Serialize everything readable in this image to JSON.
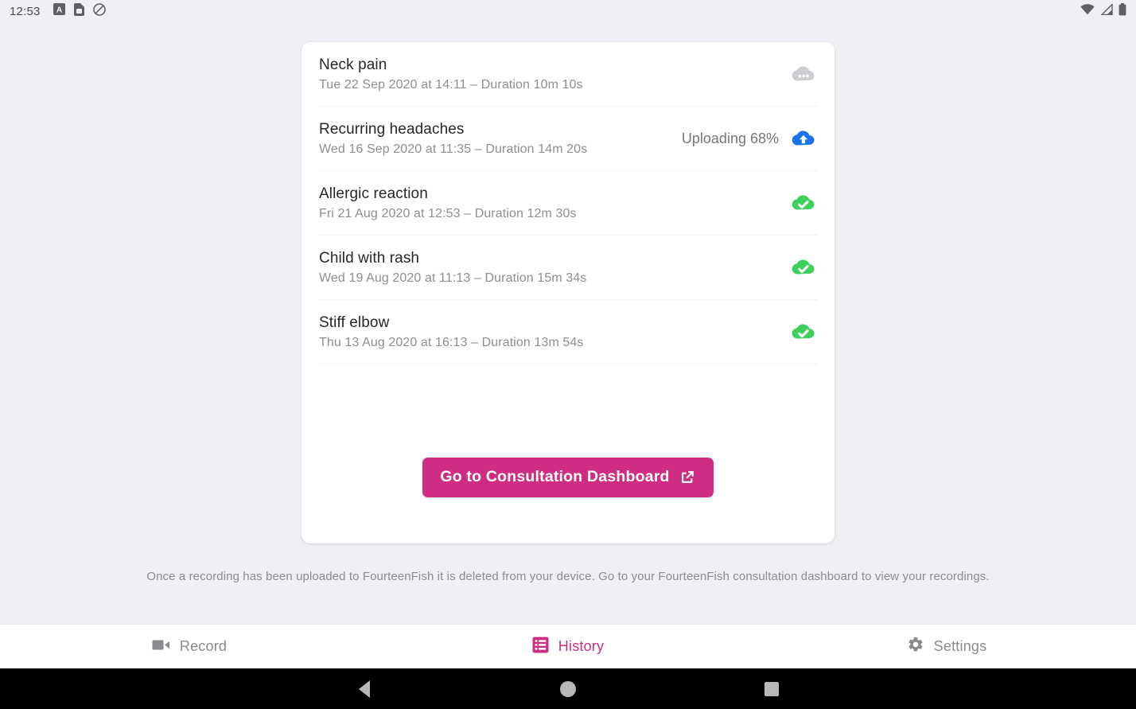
{
  "status_bar": {
    "clock": "12:53",
    "left_icons": [
      "app-badge-icon",
      "sim-card-icon",
      "do-not-disturb-icon"
    ],
    "right_icons": [
      "wifi-icon",
      "cellular-signal-icon",
      "battery-icon"
    ]
  },
  "colors": {
    "accent_pink": "#cf2d84",
    "upload_blue": "#1a73e8",
    "done_green": "#3ecf5c",
    "pending_grey": "#cdcdd2",
    "page_background": "#efeff4",
    "card_background": "#ffffff"
  },
  "recordings": [
    {
      "title": "Neck pain",
      "subtitle": "Tue 22 Sep 2020 at 14:11 – Duration 10m 10s",
      "status_text": "",
      "status_icon": "cloud-pending-icon"
    },
    {
      "title": "Recurring headaches",
      "subtitle": "Wed 16 Sep 2020 at 11:35 – Duration 14m 20s",
      "status_text": "Uploading 68%",
      "status_icon": "cloud-upload-icon"
    },
    {
      "title": "Allergic reaction",
      "subtitle": "Fri 21 Aug 2020 at 12:53 – Duration 12m 30s",
      "status_text": "",
      "status_icon": "cloud-done-icon"
    },
    {
      "title": "Child with rash",
      "subtitle": "Wed 19 Aug 2020 at 11:13 – Duration 15m 34s",
      "status_text": "",
      "status_icon": "cloud-done-icon"
    },
    {
      "title": "Stiff elbow",
      "subtitle": "Thu 13 Aug 2020 at 16:13 – Duration 13m 54s",
      "status_text": "",
      "status_icon": "cloud-done-icon"
    }
  ],
  "cta": {
    "label": "Go to Consultation Dashboard",
    "icon": "external-link-icon"
  },
  "footnote": "Once a recording has been uploaded to FourteenFish it is deleted from your device. Go to your FourteenFish consultation dashboard to view your recordings.",
  "tabs": [
    {
      "label": "Record",
      "icon": "video-camera-icon",
      "active": false
    },
    {
      "label": "History",
      "icon": "list-icon",
      "active": true
    },
    {
      "label": "Settings",
      "icon": "gear-icon",
      "active": false
    }
  ],
  "android_nav": {
    "back": "back-triangle-icon",
    "home": "home-circle-icon",
    "recents": "recents-square-icon"
  }
}
